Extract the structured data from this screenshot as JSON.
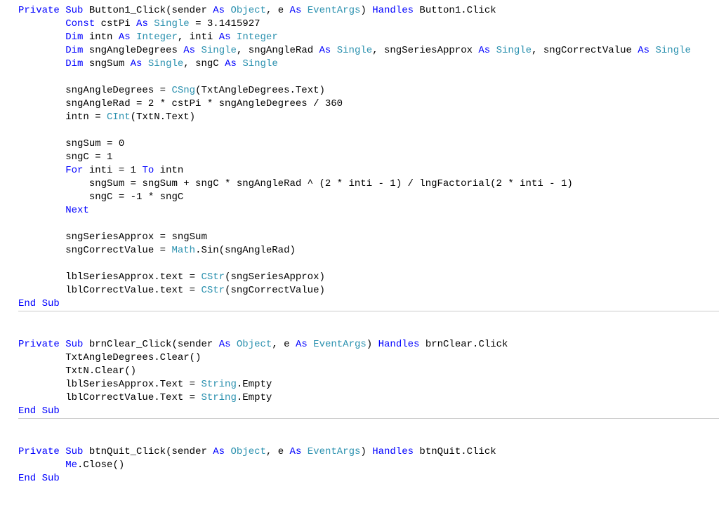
{
  "colors": {
    "keyword": "#0000ff",
    "type": "#2b91af",
    "text": "#000000",
    "separator": "#cccccc",
    "background": "#ffffff"
  },
  "font": "Consolas",
  "methods": [
    {
      "signature": {
        "kw_private": "Private",
        "kw_sub": "Sub",
        "name": "Button1_Click",
        "paren_open": "(",
        "param1_name": "sender",
        "kw_as_1": "As",
        "param1_type": "Object",
        "comma1": ", ",
        "param2_name": "e",
        "kw_as_2": "As",
        "param2_type": "EventArgs",
        "paren_close": ")",
        "kw_handles": "Handles",
        "handles_target": "Button1.Click"
      },
      "body": [
        {
          "indent": 2,
          "tokens": [
            {
              "c": "kw",
              "t": "Const"
            },
            {
              "c": "txt",
              "t": " cstPi "
            },
            {
              "c": "kw",
              "t": "As"
            },
            {
              "c": "txt",
              "t": " "
            },
            {
              "c": "typ",
              "t": "Single"
            },
            {
              "c": "txt",
              "t": " = 3.1415927"
            }
          ]
        },
        {
          "indent": 2,
          "tokens": [
            {
              "c": "kw",
              "t": "Dim"
            },
            {
              "c": "txt",
              "t": " intn "
            },
            {
              "c": "kw",
              "t": "As"
            },
            {
              "c": "txt",
              "t": " "
            },
            {
              "c": "typ",
              "t": "Integer"
            },
            {
              "c": "txt",
              "t": ", inti "
            },
            {
              "c": "kw",
              "t": "As"
            },
            {
              "c": "txt",
              "t": " "
            },
            {
              "c": "typ",
              "t": "Integer"
            }
          ]
        },
        {
          "indent": 2,
          "tokens": [
            {
              "c": "kw",
              "t": "Dim"
            },
            {
              "c": "txt",
              "t": " sngAngleDegrees "
            },
            {
              "c": "kw",
              "t": "As"
            },
            {
              "c": "txt",
              "t": " "
            },
            {
              "c": "typ",
              "t": "Single"
            },
            {
              "c": "txt",
              "t": ", sngAngleRad "
            },
            {
              "c": "kw",
              "t": "As"
            },
            {
              "c": "txt",
              "t": " "
            },
            {
              "c": "typ",
              "t": "Single"
            },
            {
              "c": "txt",
              "t": ", sngSeriesApprox "
            },
            {
              "c": "kw",
              "t": "As"
            },
            {
              "c": "txt",
              "t": " "
            },
            {
              "c": "typ",
              "t": "Single"
            },
            {
              "c": "txt",
              "t": ", sngCorrectValue "
            },
            {
              "c": "kw",
              "t": "As"
            },
            {
              "c": "txt",
              "t": " "
            },
            {
              "c": "typ",
              "t": "Single"
            }
          ]
        },
        {
          "indent": 2,
          "tokens": [
            {
              "c": "kw",
              "t": "Dim"
            },
            {
              "c": "txt",
              "t": " sngSum "
            },
            {
              "c": "kw",
              "t": "As"
            },
            {
              "c": "txt",
              "t": " "
            },
            {
              "c": "typ",
              "t": "Single"
            },
            {
              "c": "txt",
              "t": ", sngC "
            },
            {
              "c": "kw",
              "t": "As"
            },
            {
              "c": "txt",
              "t": " "
            },
            {
              "c": "typ",
              "t": "Single"
            }
          ]
        },
        {
          "indent": 0,
          "tokens": []
        },
        {
          "indent": 2,
          "tokens": [
            {
              "c": "txt",
              "t": "sngAngleDegrees = "
            },
            {
              "c": "fn",
              "t": "CSng"
            },
            {
              "c": "txt",
              "t": "(TxtAngleDegrees.Text)"
            }
          ]
        },
        {
          "indent": 2,
          "tokens": [
            {
              "c": "txt",
              "t": "sngAngleRad = 2 * cstPi * sngAngleDegrees / 360"
            }
          ]
        },
        {
          "indent": 2,
          "tokens": [
            {
              "c": "txt",
              "t": "intn = "
            },
            {
              "c": "fn",
              "t": "CInt"
            },
            {
              "c": "txt",
              "t": "(TxtN.Text)"
            }
          ]
        },
        {
          "indent": 0,
          "tokens": []
        },
        {
          "indent": 2,
          "tokens": [
            {
              "c": "txt",
              "t": "sngSum = 0"
            }
          ]
        },
        {
          "indent": 2,
          "tokens": [
            {
              "c": "txt",
              "t": "sngC = 1"
            }
          ]
        },
        {
          "indent": 2,
          "tokens": [
            {
              "c": "kw",
              "t": "For"
            },
            {
              "c": "txt",
              "t": " inti = 1 "
            },
            {
              "c": "kw",
              "t": "To"
            },
            {
              "c": "txt",
              "t": " intn"
            }
          ]
        },
        {
          "indent": 3,
          "tokens": [
            {
              "c": "txt",
              "t": "sngSum = sngSum + sngC * sngAngleRad ^ (2 * inti - 1) / lngFactorial(2 * inti - 1)"
            }
          ]
        },
        {
          "indent": 3,
          "tokens": [
            {
              "c": "txt",
              "t": "sngC = -1 * sngC"
            }
          ]
        },
        {
          "indent": 2,
          "tokens": [
            {
              "c": "kw",
              "t": "Next"
            }
          ]
        },
        {
          "indent": 0,
          "tokens": []
        },
        {
          "indent": 2,
          "tokens": [
            {
              "c": "txt",
              "t": "sngSeriesApprox = sngSum"
            }
          ]
        },
        {
          "indent": 2,
          "tokens": [
            {
              "c": "txt",
              "t": "sngCorrectValue = "
            },
            {
              "c": "typ",
              "t": "Math"
            },
            {
              "c": "txt",
              "t": ".Sin(sngAngleRad)"
            }
          ]
        },
        {
          "indent": 0,
          "tokens": []
        },
        {
          "indent": 2,
          "tokens": [
            {
              "c": "txt",
              "t": "lblSeriesApprox.text = "
            },
            {
              "c": "fn",
              "t": "CStr"
            },
            {
              "c": "txt",
              "t": "(sngSeriesApprox)"
            }
          ]
        },
        {
          "indent": 2,
          "tokens": [
            {
              "c": "txt",
              "t": "lblCorrectValue.text = "
            },
            {
              "c": "fn",
              "t": "CStr"
            },
            {
              "c": "txt",
              "t": "(sngCorrectValue)"
            }
          ]
        }
      ],
      "end": {
        "kw_end": "End",
        "kw_sub": "Sub"
      }
    },
    {
      "signature": {
        "kw_private": "Private",
        "kw_sub": "Sub",
        "name": "brnClear_Click",
        "paren_open": "(",
        "param1_name": "sender",
        "kw_as_1": "As",
        "param1_type": "Object",
        "comma1": ", ",
        "param2_name": "e",
        "kw_as_2": "As",
        "param2_type": "EventArgs",
        "paren_close": ")",
        "kw_handles": "Handles",
        "handles_target": "brnClear.Click"
      },
      "body": [
        {
          "indent": 2,
          "tokens": [
            {
              "c": "txt",
              "t": "TxtAngleDegrees.Clear()"
            }
          ]
        },
        {
          "indent": 2,
          "tokens": [
            {
              "c": "txt",
              "t": "TxtN.Clear()"
            }
          ]
        },
        {
          "indent": 2,
          "tokens": [
            {
              "c": "txt",
              "t": "lblSeriesApprox.Text = "
            },
            {
              "c": "typ",
              "t": "String"
            },
            {
              "c": "txt",
              "t": ".Empty"
            }
          ]
        },
        {
          "indent": 2,
          "tokens": [
            {
              "c": "txt",
              "t": "lblCorrectValue.Text = "
            },
            {
              "c": "typ",
              "t": "String"
            },
            {
              "c": "txt",
              "t": ".Empty"
            }
          ]
        }
      ],
      "end": {
        "kw_end": "End",
        "kw_sub": "Sub"
      }
    },
    {
      "signature": {
        "kw_private": "Private",
        "kw_sub": "Sub",
        "name": "btnQuit_Click",
        "paren_open": "(",
        "param1_name": "sender",
        "kw_as_1": "As",
        "param1_type": "Object",
        "comma1": ", ",
        "param2_name": "e",
        "kw_as_2": "As",
        "param2_type": "EventArgs",
        "paren_close": ")",
        "kw_handles": "Handles",
        "handles_target": "btnQuit.Click"
      },
      "body": [
        {
          "indent": 2,
          "tokens": [
            {
              "c": "kw",
              "t": "Me"
            },
            {
              "c": "txt",
              "t": ".Close()"
            }
          ]
        }
      ],
      "end": {
        "kw_end": "End",
        "kw_sub": "Sub"
      }
    }
  ]
}
